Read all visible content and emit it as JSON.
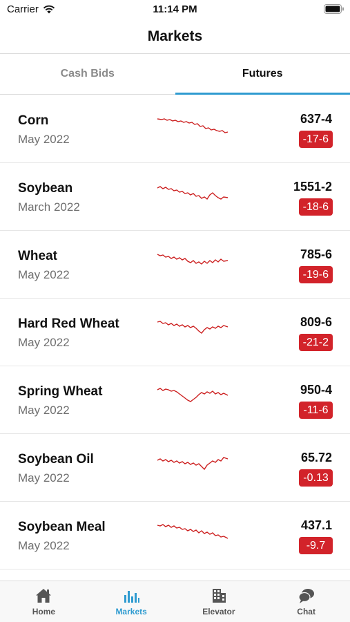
{
  "status": {
    "carrier": "Carrier",
    "time": "11:14 PM"
  },
  "header": {
    "title": "Markets"
  },
  "tabs": [
    {
      "label": "Cash Bids",
      "active": false
    },
    {
      "label": "Futures",
      "active": true
    }
  ],
  "markets": [
    {
      "name": "Corn",
      "month": "May 2022",
      "price": "637-4",
      "change": "-17-6"
    },
    {
      "name": "Soybean",
      "month": "March 2022",
      "price": "1551-2",
      "change": "-18-6"
    },
    {
      "name": "Wheat",
      "month": "May 2022",
      "price": "785-6",
      "change": "-19-6"
    },
    {
      "name": "Hard Red Wheat",
      "month": "May 2022",
      "price": "809-6",
      "change": "-21-2"
    },
    {
      "name": "Spring Wheat",
      "month": "May 2022",
      "price": "950-4",
      "change": "-11-6"
    },
    {
      "name": "Soybean Oil",
      "month": "May 2022",
      "price": "65.72",
      "change": "-0.13"
    },
    {
      "name": "Soybean Meal",
      "month": "May 2022",
      "price": "437.1",
      "change": "-9.7"
    }
  ],
  "bottom_nav": [
    {
      "label": "Home",
      "icon": "home-icon",
      "active": false
    },
    {
      "label": "Markets",
      "icon": "bar-chart-icon",
      "active": true
    },
    {
      "label": "Elevator",
      "icon": "building-icon",
      "active": false
    },
    {
      "label": "Chat",
      "icon": "chat-icon",
      "active": false
    }
  ],
  "colors": {
    "accent": "#2f9bd0",
    "negative": "#d2232a",
    "sparkline": "#cc1f1f"
  }
}
